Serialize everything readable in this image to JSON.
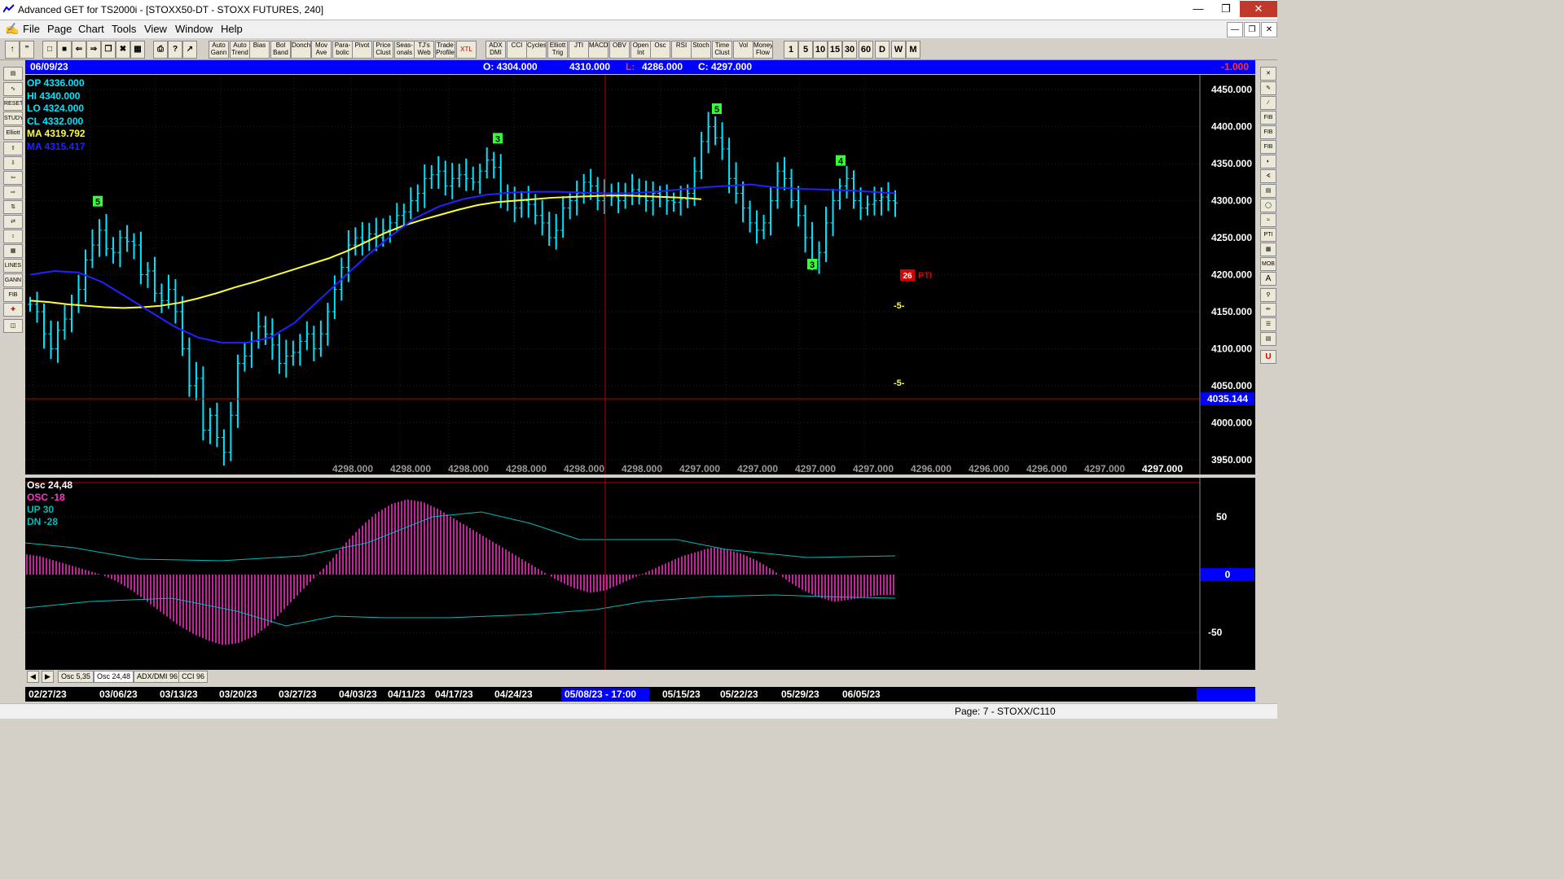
{
  "window": {
    "title": "Advanced GET for TS2000i - [STOXX50-DT - STOXX FUTURES, 240]"
  },
  "menu": [
    "File",
    "Page",
    "Chart",
    "Tools",
    "View",
    "Window",
    "Help"
  ],
  "toolbar": {
    "studies": [
      "Auto Gann",
      "Auto Trend",
      "Bias",
      "Bol Band",
      "Donch",
      "Mov Ave",
      "Para- bolic",
      "Pivot",
      "Price Clust",
      "Seas- onals",
      "TJ's Web",
      "Trade Profile",
      "XTL",
      "ADX DMI",
      "CCI",
      "Cycles",
      "Elliott Trig",
      "JTI",
      "MACD",
      "OBV",
      "Open Int",
      "Osc",
      "RSI",
      "Stoch",
      "Time Clust",
      "Vol",
      "Money Flow"
    ],
    "timeframes": [
      "1",
      "5",
      "10",
      "15",
      "30",
      "60",
      "D",
      "W",
      "M"
    ]
  },
  "infobar": {
    "date": "06/09/23",
    "open": "O: 4304.000",
    "high": "4310.000",
    "low_label": "L:",
    "low": "4286.000",
    "close": "C: 4297.000",
    "change": "-1.000"
  },
  "legend": {
    "op": "OP  4336.000",
    "hi": "HI   4340.000",
    "lo": "LO  4324.000",
    "cl": "CL  4332.000",
    "ma1": "MA  4319.792",
    "ma2": "MA  4315.417"
  },
  "price_axis": {
    "ticks": [
      "4450.000",
      "4400.000",
      "4350.000",
      "4300.000",
      "4250.000",
      "4200.000",
      "4150.000",
      "4100.000",
      "4050.000",
      "4000.000",
      "3950.000"
    ],
    "cursor_price": "4035.144"
  },
  "bottom_values": [
    "4298.000",
    "4298.000",
    "4298.000",
    "4298.000",
    "4298.000",
    "4298.000",
    "4297.000",
    "4297.000",
    "4297.000",
    "4297.000",
    "4296.000",
    "4296.000",
    "4296.000",
    "4297.000",
    "4297.000"
  ],
  "elliott_labels": {
    "pti_value": "26",
    "pti_text": "PTI",
    "target_top": "-5-",
    "target_bottom": "-5-"
  },
  "osc": {
    "title": "Osc 24,48",
    "osc": "OSC -18",
    "up": "UP   30",
    "dn": "DN   -28",
    "ticks": [
      "50",
      "0",
      "-50"
    ]
  },
  "tabs": [
    "Osc 5,35",
    "Osc 24,48",
    "ADX/DMI 96",
    "CCI 96"
  ],
  "dates": [
    "02/27/23",
    "03/06/23",
    "03/13/23",
    "03/20/23",
    "03/27/23",
    "04/03/23",
    "04/11/23",
    "04/17/23",
    "04/24/23",
    "05/08/23 - 17:00",
    "05/15/23",
    "05/22/23",
    "05/29/23",
    "06/05/23"
  ],
  "status": {
    "page": "Page: 7 - STOXX/C110"
  },
  "colors": {
    "bars": "#00e5ff",
    "ma_fast": "#ffff33",
    "ma_slow": "#2222ff",
    "osc": "#ff33cc",
    "bands": "#00bbbb",
    "wave": "#33ff33",
    "label_magenta": "#ff33ff",
    "infobar": "#0000ff"
  },
  "chart_data": {
    "type": "bar",
    "title": "STOXX50-DT - STOXX FUTURES, 240",
    "ylim": [
      3930,
      4470
    ],
    "x_dates": [
      "02/27/23",
      "03/06/23",
      "03/13/23",
      "03/20/23",
      "03/27/23",
      "04/03/23",
      "04/11/23",
      "04/17/23",
      "04/24/23",
      "05/08/23",
      "05/15/23",
      "05/22/23",
      "05/29/23",
      "06/05/23"
    ],
    "close_series": [
      4160,
      4150,
      4120,
      4100,
      4125,
      4140,
      4160,
      4180,
      4220,
      4240,
      4260,
      4235,
      4230,
      4250,
      4245,
      4240,
      4200,
      4205,
      4175,
      4165,
      4180,
      4150,
      4100,
      4050,
      4060,
      3990,
      4010,
      3980,
      3960,
      4010,
      4080,
      4090,
      4110,
      4130,
      4120,
      4105,
      4080,
      4090,
      4095,
      4110,
      4120,
      4100,
      4120,
      4150,
      4180,
      4210,
      4240,
      4250,
      4245,
      4255,
      4250,
      4260,
      4270,
      4280,
      4285,
      4300,
      4310,
      4330,
      4335,
      4340,
      4320,
      4330,
      4335,
      4330,
      4325,
      4340,
      4355,
      4345,
      4310,
      4300,
      4290,
      4300,
      4295,
      4280,
      4270,
      4250,
      4260,
      4290,
      4300,
      4310,
      4325,
      4320,
      4300,
      4310,
      4305,
      4300,
      4310,
      4315,
      4305,
      4300,
      4310,
      4305,
      4300,
      4298,
      4302,
      4310,
      4340,
      4380,
      4400,
      4385,
      4370,
      4330,
      4310,
      4290,
      4270,
      4260,
      4270,
      4300,
      4340,
      4330,
      4300,
      4280,
      4250,
      4220,
      4230,
      4270,
      4300,
      4320,
      4330,
      4300,
      4290,
      4295,
      4300,
      4305,
      4300,
      4297
    ],
    "ma_fast": [
      4165,
      4163,
      4160,
      4158,
      4156,
      4155,
      4156,
      4158,
      4162,
      4168,
      4175,
      4183,
      4190,
      4198,
      4206,
      4214,
      4222,
      4232,
      4244,
      4256,
      4266,
      4274,
      4281,
      4288,
      4294,
      4298,
      4300,
      4302,
      4304,
      4305,
      4306,
      4307,
      4307,
      4306,
      4305,
      4304,
      4302
    ],
    "ma_slow": [
      4200,
      4205,
      4203,
      4190,
      4170,
      4150,
      4130,
      4115,
      4108,
      4108,
      4115,
      4135,
      4165,
      4195,
      4225,
      4252,
      4276,
      4292,
      4302,
      4308,
      4311,
      4312,
      4312,
      4311,
      4310,
      4310,
      4312,
      4315,
      4318,
      4320,
      4322,
      4318,
      4316,
      4315,
      4314,
      4312,
      4310
    ],
    "waves": [
      {
        "label": "5",
        "boxed": true,
        "price": 4290
      },
      {
        "label": "3",
        "boxed": true,
        "price": 4375
      },
      {
        "label": "5",
        "boxed": true,
        "price": 4415
      },
      {
        "label": "4",
        "boxed": true,
        "price": 4345
      },
      {
        "label": "3",
        "boxed": true,
        "price": 4205
      }
    ],
    "oscillator": {
      "type": "histogram",
      "name": "OSC",
      "values": [
        18,
        16,
        12,
        8,
        4,
        0,
        -6,
        -14,
        -24,
        -34,
        -44,
        -52,
        -58,
        -62,
        -60,
        -54,
        -44,
        -30,
        -16,
        -2,
        12,
        28,
        42,
        54,
        62,
        66,
        64,
        58,
        50,
        42,
        34,
        26,
        18,
        10,
        2,
        -6,
        -12,
        -16,
        -14,
        -8,
        -2,
        4,
        10,
        16,
        20,
        24,
        22,
        18,
        12,
        4,
        -6,
        -14,
        -20,
        -24,
        -22,
        -20,
        -18
      ]
    }
  }
}
